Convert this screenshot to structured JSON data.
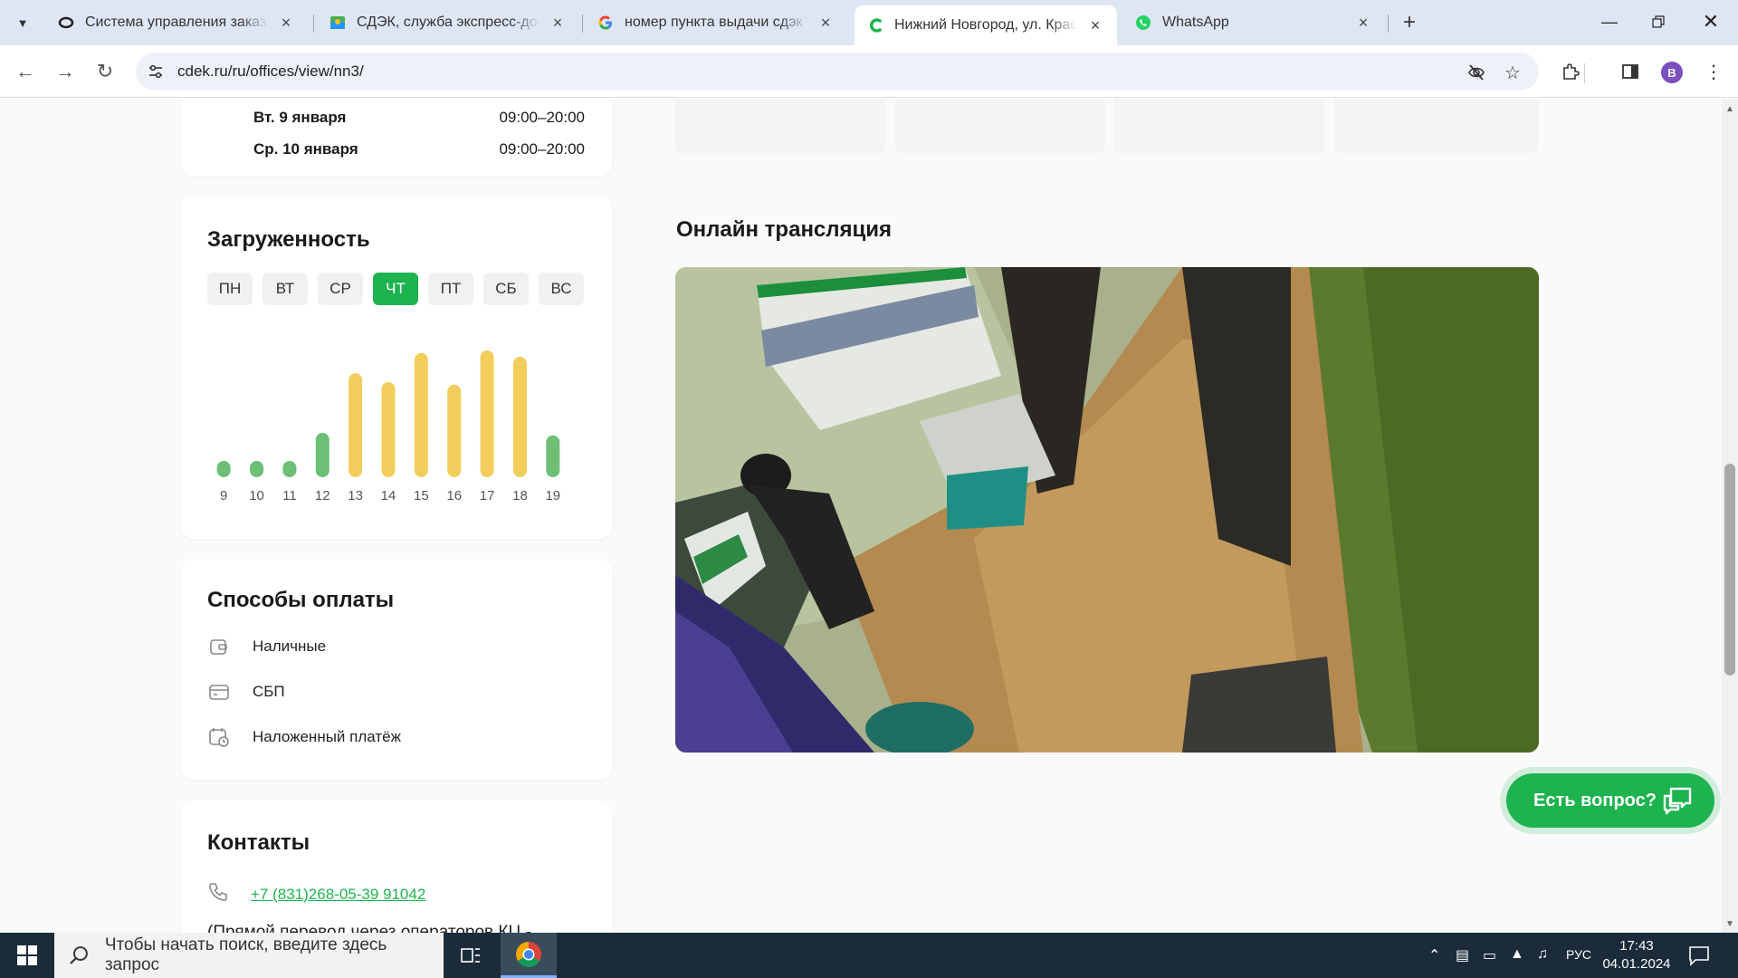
{
  "browser": {
    "tabs": [
      {
        "title": "Система управления заказами",
        "favicon": "cdek-circle-icon",
        "active": false
      },
      {
        "title": "СДЭК, служба экспресс-доставки",
        "favicon": "yandex-maps-icon",
        "active": false
      },
      {
        "title": "номер пункта выдачи сдэк нижний",
        "favicon": "google-icon",
        "active": false
      },
      {
        "title": "Нижний Новгород, ул. Красных",
        "favicon": "cdek-c-icon",
        "active": true
      },
      {
        "title": "WhatsApp",
        "favicon": "whatsapp-icon",
        "active": false
      }
    ],
    "url": "cdek.ru/ru/offices/view/nn3/",
    "profile_initial": "B"
  },
  "schedule": {
    "rows": [
      {
        "day": "Вт. 9 января",
        "hours": "09:00–20:00"
      },
      {
        "day": "Ср. 10 января",
        "hours": "09:00–20:00"
      }
    ]
  },
  "load": {
    "title": "Загруженность",
    "days": [
      "ПН",
      "ВТ",
      "СР",
      "ЧТ",
      "ПТ",
      "СБ",
      "ВС"
    ],
    "active_day": "ЧТ",
    "colors": {
      "low": "#6cbf75",
      "high": "#f2cd5c",
      "active": "#1db34f"
    }
  },
  "chart_data": {
    "type": "bar",
    "categories": [
      "9",
      "10",
      "11",
      "12",
      "13",
      "14",
      "15",
      "16",
      "17",
      "18",
      "19"
    ],
    "values": [
      0.1,
      0.1,
      0.12,
      0.35,
      0.82,
      0.75,
      0.98,
      0.73,
      1.0,
      0.95,
      0.33
    ],
    "levels": [
      "low",
      "low",
      "low",
      "low",
      "high",
      "high",
      "high",
      "high",
      "high",
      "high",
      "low"
    ],
    "ylim": [
      0,
      1
    ]
  },
  "payment": {
    "title": "Способы оплаты",
    "items": [
      {
        "label": "Наличные",
        "icon": "wallet-icon"
      },
      {
        "label": "СБП",
        "icon": "card-icon"
      },
      {
        "label": "Наложенный платёж",
        "icon": "calendar-clock-icon"
      }
    ]
  },
  "stream": {
    "title": "Онлайн трансляция"
  },
  "contacts": {
    "title": "Контакты",
    "phone": "+7 (831)268-05-39 91042",
    "note": "(Прямой перевод через операторов КЦ -"
  },
  "help_button": {
    "label": "Есть вопрос?"
  },
  "taskbar": {
    "search_placeholder": "Чтобы начать поиск, введите здесь запрос",
    "language": "РУС",
    "time": "17:43",
    "date": "04.01.2024"
  }
}
